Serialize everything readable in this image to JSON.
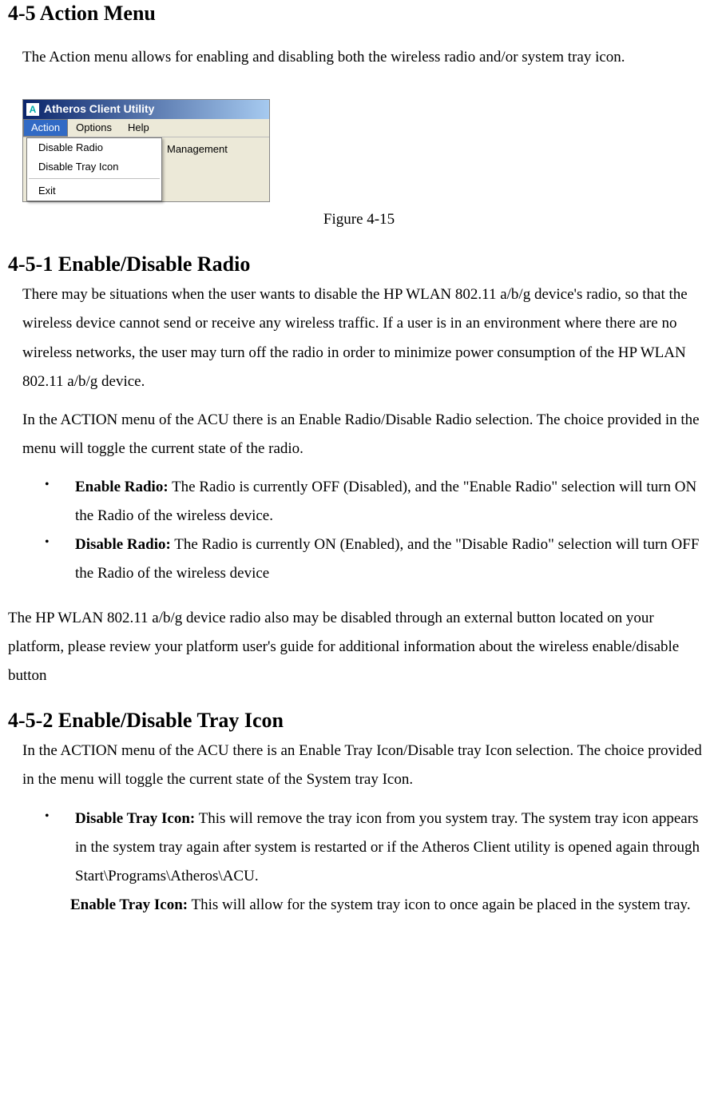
{
  "heading_main": "4-5 Action Menu",
  "intro": "The Action menu allows for enabling and disabling both the wireless radio and/or system tray icon.",
  "screenshot": {
    "title": "Atheros Client Utility",
    "icon_letter": "A",
    "menu_action": "Action",
    "menu_options": "Options",
    "menu_help": "Help",
    "item_disable_radio": "Disable Radio",
    "item_disable_tray": "Disable Tray Icon",
    "item_exit": "Exit",
    "tab_label": "Management"
  },
  "figure_caption": "Figure 4-15",
  "heading_451": "4-5-1 Enable/Disable Radio",
  "p_451_1": "There may be situations when the user wants to disable the HP WLAN 802.11 a/b/g  device's radio, so that the wireless device cannot send or receive any wireless traffic.  If a user is in an environment where there are no wireless networks, the user may turn off the radio in order to minimize power consumption of the HP WLAN 802.11 a/b/g  device.",
  "p_451_2": "In the ACTION menu of the ACU there is an Enable Radio/Disable Radio selection.  The choice provided in the menu will toggle the current state of the radio.",
  "bullet_enable_radio_label": "Enable Radio:",
  "bullet_enable_radio_text": "  The Radio is currently OFF (Disabled), and the \"Enable Radio\" selection will turn ON the Radio of the wireless device.",
  "bullet_disable_radio_label": "Disable Radio:",
  "bullet_disable_radio_text": "  The Radio is currently ON (Enabled), and the \"Disable Radio\" selection will turn OFF the Radio of the wireless device",
  "p_451_3": "The HP WLAN 802.11 a/b/g  device radio also may be disabled through an external button located on your platform, please review your platform user's guide for additional information about the wireless enable/disable button",
  "heading_452": "4-5-2 Enable/Disable Tray Icon",
  "p_452_1": "In the ACTION menu of the ACU there is an Enable Tray Icon/Disable tray Icon selection.  The choice provided in the menu will toggle the current state of the System tray Icon.",
  "bullet_disable_tray_label": "Disable Tray Icon:",
  "bullet_disable_tray_text": "  This will remove the tray icon from you system tray.  The system tray icon appears in the system tray again after system is restarted or if the Atheros Client utility is opened again through Start\\Programs\\Atheros\\ACU.",
  "bullet_enable_tray_label": "Enable Tray Icon:",
  "bullet_enable_tray_text": "  This will allow for the system tray icon to once again be placed in the system tray."
}
